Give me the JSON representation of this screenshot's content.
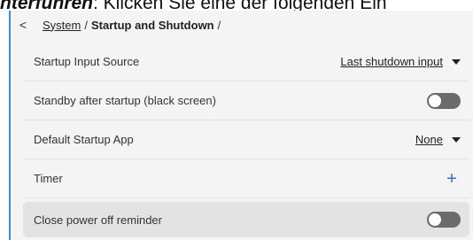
{
  "doc_header": {
    "bold_italic": "hterführen",
    "rest": ": Klicken Sie eine der folgenden Ein"
  },
  "breadcrumb": {
    "back_icon": "chevron-left-icon",
    "link": "System",
    "separator1": "/",
    "current": "Startup and Shutdown",
    "separator2": "/"
  },
  "rows": {
    "startup_input_source": {
      "label": "Startup Input Source",
      "value": "Last shutdown input"
    },
    "standby_after_startup": {
      "label": "Standby after startup (black screen)",
      "toggle_on": false
    },
    "default_startup_app": {
      "label": "Default Startup App",
      "value": "None"
    },
    "timer": {
      "label": "Timer",
      "action": "+"
    },
    "close_power_off_reminder": {
      "label": "Close power off reminder",
      "toggle_on": false
    }
  },
  "colors": {
    "accent": "#2f6fd6",
    "toggle_off": "#6b6b6b",
    "background": "#f4f4f4",
    "highlight_row": "#e3e3e3"
  }
}
